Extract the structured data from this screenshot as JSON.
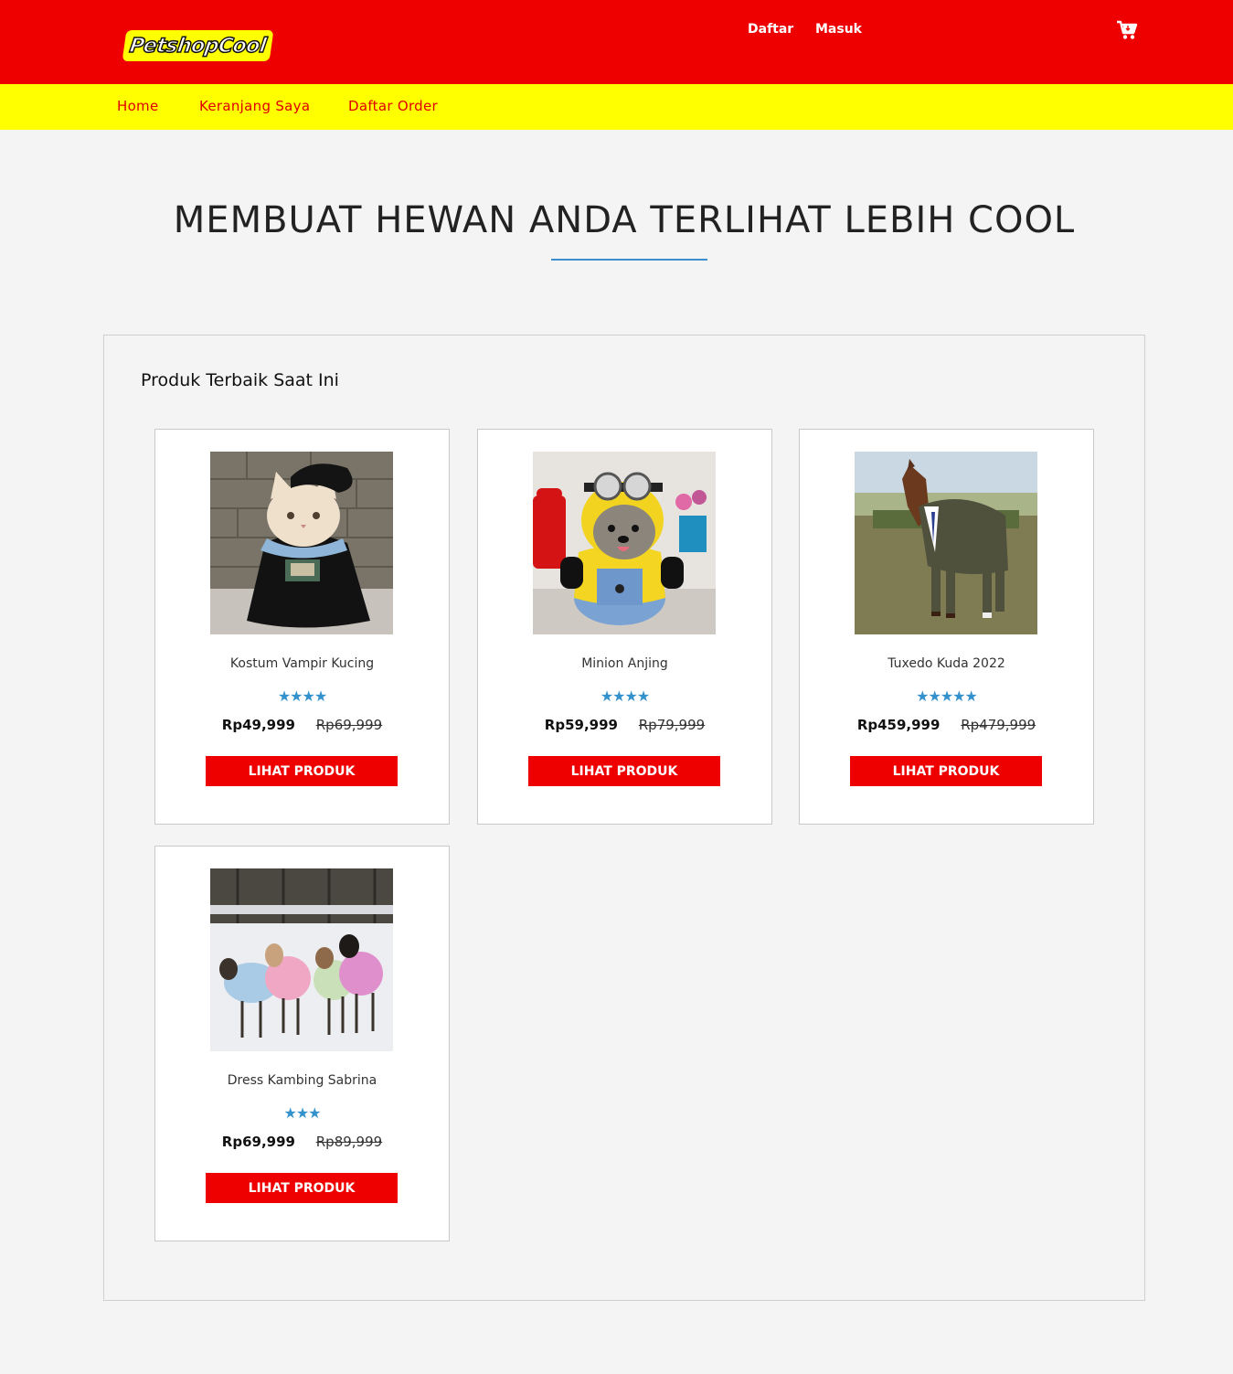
{
  "header": {
    "logo_text": "PetshopCool",
    "register_label": "Daftar",
    "login_label": "Masuk",
    "cart_icon": "cart-icon"
  },
  "nav": {
    "items": [
      {
        "label": "Home"
      },
      {
        "label": "Keranjang Saya"
      },
      {
        "label": "Daftar Order"
      }
    ]
  },
  "hero": {
    "title": "MEMBUAT HEWAN ANDA TERLIHAT LEBIH COOL"
  },
  "section": {
    "title": "Produk Terbaik Saat Ini"
  },
  "products": [
    {
      "name": "Kostum Vampir Kucing",
      "stars": "★★★★",
      "rating": 4,
      "price": "Rp49,999",
      "old_price": "Rp69,999",
      "button": "LIHAT PRODUK"
    },
    {
      "name": "Minion Anjing",
      "stars": "★★★★",
      "rating": 4,
      "price": "Rp59,999",
      "old_price": "Rp79,999",
      "button": "LIHAT PRODUK"
    },
    {
      "name": "Tuxedo Kuda 2022",
      "stars": "★★★★★",
      "rating": 5,
      "price": "Rp459,999",
      "old_price": "Rp479,999",
      "button": "LIHAT PRODUK"
    },
    {
      "name": "Dress Kambing Sabrina",
      "stars": "★★★",
      "rating": 3,
      "price": "Rp69,999",
      "old_price": "Rp89,999",
      "button": "LIHAT PRODUK"
    }
  ],
  "colors": {
    "header_red": "#ee0000",
    "nav_yellow": "#ffff00",
    "star_blue": "#3391cc",
    "accent_blue": "#3c8fcf"
  }
}
